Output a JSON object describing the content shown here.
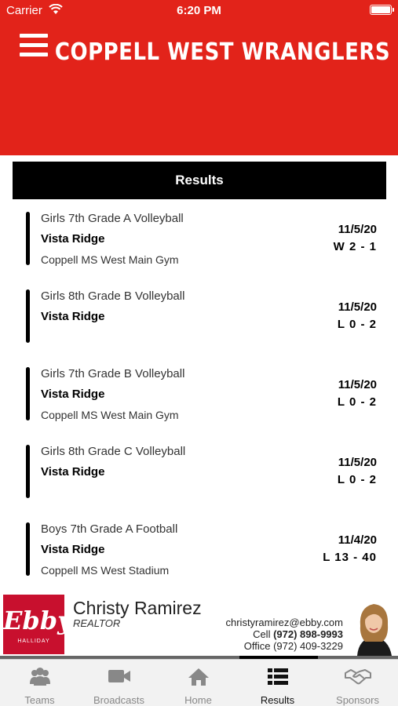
{
  "status_bar": {
    "carrier": "Carrier",
    "time": "6:20 PM"
  },
  "header": {
    "title": "COPPELL WEST WRANGLERS",
    "color": "#e2231a"
  },
  "results_header": {
    "label": "Results"
  },
  "results": [
    {
      "event": "Girls 7th Grade A Volleyball",
      "opponent": "Vista Ridge",
      "venue": "Coppell MS West Main Gym",
      "date": "11/5/20",
      "score": "W 2 - 1"
    },
    {
      "event": "Girls 8th Grade B Volleyball",
      "opponent": "Vista Ridge",
      "venue": "",
      "date": "11/5/20",
      "score": "L 0 - 2"
    },
    {
      "event": "Girls 7th Grade B Volleyball",
      "opponent": "Vista Ridge",
      "venue": "Coppell MS West Main Gym",
      "date": "11/5/20",
      "score": "L 0 - 2"
    },
    {
      "event": "Girls 8th Grade C Volleyball",
      "opponent": "Vista Ridge",
      "venue": "",
      "date": "11/5/20",
      "score": "L 0 - 2"
    },
    {
      "event": "Boys 7th Grade A Football",
      "opponent": "Vista Ridge",
      "venue": "Coppell MS West Stadium",
      "date": "11/4/20",
      "score": "L 13 - 40"
    }
  ],
  "sponsor": {
    "logo_text": "Ebby",
    "logo_sub": "HALLIDAY",
    "name": "Christy Ramirez",
    "role": "REALTOR",
    "email": "christyramirez@ebby.com",
    "cell_label": "Cell",
    "cell": "(972) 898-9993",
    "office_label": "Office",
    "office": "(972) 409-3229"
  },
  "tabs": [
    {
      "label": "Teams",
      "icon": "people-icon"
    },
    {
      "label": "Broadcasts",
      "icon": "video-camera-icon"
    },
    {
      "label": "Home",
      "icon": "home-icon"
    },
    {
      "label": "Results",
      "icon": "list-icon",
      "active": true
    },
    {
      "label": "Sponsors",
      "icon": "handshake-icon"
    }
  ]
}
